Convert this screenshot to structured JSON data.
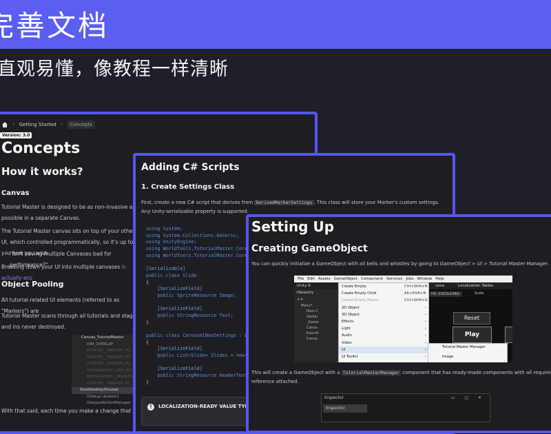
{
  "banner": {
    "title": "完善文档",
    "subtitle": "直观易懂，像教程一样清晰"
  },
  "card1": {
    "breadcrumb": [
      "Getting Started",
      "Concepts"
    ],
    "version": "Version: 3.0",
    "heading": "Concepts",
    "how_heading": "How it works?",
    "canvas_heading": "Canvas",
    "p1": "Tutorial Master is designed to be as non-invasive as possible in a separate Canvas.",
    "p2": "The Tutorial Master canvas sits on top of your other UI, which controlled programmatically, so it's up to you how you wish",
    "p3": "\"Isn't having multiple Canvases bad for performance?\"",
    "p4_text": "Breaking down your UI into multiple canvases ",
    "p4_link": "is actually enc",
    "pool_heading": "Object Pooling",
    "p5": "All tutorial-related UI elements (referred to as \"Markers\") are",
    "p6": "Tutorial Master scans through all tutorials and stages and ins never destroyed.",
    "p7": "With that said, each time you make a change that involves a",
    "hierarchy": [
      "Canvas_TutorialMaster",
      "DIM_OVERLAY",
      "POINTER__MARKER_PO",
      "POINTER__MARKER_PO",
      "POINTER__MARKER_PO",
      "MESSAGEBOX_2WD_BU",
      "MESSAGEBOX__MARKER",
      "POINTER__MARKER_PO",
      "DontDestroyOnLoad",
      "[Debug Updater]",
      "DelayedActionManager"
    ]
  },
  "card2": {
    "heading": "Adding C# Scripts",
    "subheading": "1. Create Settings Class",
    "p_pre": "First, create a new C# script that derives from ",
    "p_code": "DerivedMarkerSettings",
    "p_post": ". This class will store your Marker's custom settings. Any Unity-serializable property is supported.",
    "code": [
      "using System;",
      "using System.Collections.Generic;",
      "using UnityEngine;",
      "using WorldTools.TutorialMaster.Core.Dat",
      "using WorldTools.TutorialMaster.Core.Dat",
      "",
      "[Serializable]",
      "public class Slide",
      "{",
      "    [SerializeField]",
      "    public SpriteResource Image;",
      "",
      "    [SerializeField]",
      "    public StringResource Text;",
      "}",
      "",
      "public class CarouselBoxSettings : Deriv",
      "{",
      "    [SerializeField]",
      "    public List<Slide> Slides = new();",
      "",
      "    [SerializeField]",
      "    public StringResource HeaderText = n",
      "}"
    ],
    "callout_title": "LOCALIZATION-READY VALUE TYPES",
    "callout_icon": "!"
  },
  "card3": {
    "heading": "Setting Up",
    "subheading": "Creating GameObject",
    "p1_pre": "You can quickly initialize a GameObject with all bells and whistles by going to ",
    "p1_path": "GameObject > UI > Tutorial Master Manager",
    "p1_post": ".",
    "p2_pre": "This will create a GameObject with a ",
    "p2_code": "TutorialMasterManager",
    "p2_post": " component that has ready-made components with all required reference attached.",
    "unity": {
      "menubar": [
        "File",
        "Edit",
        "Assets",
        "GameObject",
        "Component",
        "Services",
        "Jobs",
        "Window",
        "Help"
      ],
      "toolbar_left": "Unity 6",
      "toolbar_scene": "cene",
      "toolbar_loc": "Localization Tables",
      "hierarchy_tab": "Hierarchy",
      "hierarchy_items": [
        "Menu*",
        "Main C",
        "Global",
        "_Game",
        "Canva",
        "EventS",
        "Canva"
      ],
      "game_res": "HD (1920x1080)",
      "game_scale": "Scale",
      "menu_items": [
        {
          "label": "Create Empty",
          "shortcut": "Ctrl+Shift+N",
          "arrow": "",
          "state": ""
        },
        {
          "label": "Create Empty Child",
          "shortcut": "Alt+Shift+N",
          "arrow": "",
          "state": ""
        },
        {
          "label": "Create Empty Parent",
          "shortcut": "Ctrl+Shift+G",
          "arrow": "",
          "state": "disabled"
        },
        {
          "label": "2D Object",
          "shortcut": "",
          "arrow": "›",
          "state": ""
        },
        {
          "label": "3D Object",
          "shortcut": "",
          "arrow": "›",
          "state": ""
        },
        {
          "label": "Effects",
          "shortcut": "",
          "arrow": "›",
          "state": ""
        },
        {
          "label": "Light",
          "shortcut": "",
          "arrow": "›",
          "state": ""
        },
        {
          "label": "Audio",
          "shortcut": "",
          "arrow": "›",
          "state": ""
        },
        {
          "label": "Video",
          "shortcut": "",
          "arrow": "›",
          "state": ""
        },
        {
          "label": "UI",
          "shortcut": "",
          "arrow": "›",
          "state": "hl"
        },
        {
          "label": "UI Toolkit",
          "shortcut": "",
          "arrow": "›",
          "state": ""
        }
      ],
      "submenu": [
        "Tutorial Master Manager",
        "Image"
      ],
      "reset": "Reset",
      "play": "Play"
    },
    "inspector": {
      "title": "Inspector",
      "tab": "Inspector",
      "controls": "▭ ▢ ✕"
    }
  }
}
